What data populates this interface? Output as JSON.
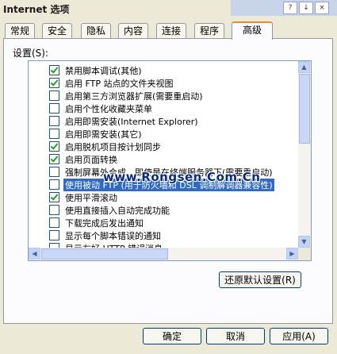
{
  "window": {
    "title": "Internet 选项"
  },
  "title_buttons": [
    "?",
    "↓",
    "×"
  ],
  "tabs": [
    {
      "label": "常规",
      "active": false
    },
    {
      "label": "安全",
      "active": false
    },
    {
      "label": "隐私",
      "active": false
    },
    {
      "label": "内容",
      "active": false
    },
    {
      "label": "连接",
      "active": false
    },
    {
      "label": "程序",
      "active": false
    },
    {
      "label": "高级",
      "active": true
    }
  ],
  "settings_label": "设置(S):",
  "settings": [
    {
      "label": "禁用脚本调试(其他)",
      "checked": true
    },
    {
      "label": "启用 FTP 站点的文件夹视图",
      "checked": true
    },
    {
      "label": "启用第三方浏览器扩展(需要重启动)",
      "checked": false
    },
    {
      "label": "启用个性化收藏夹菜单",
      "checked": false
    },
    {
      "label": "启用即需安装(Internet Explorer)",
      "checked": false
    },
    {
      "label": "启用即需安装(其它)",
      "checked": false
    },
    {
      "label": "启用脱机项目按计划同步",
      "checked": true
    },
    {
      "label": "启用页面转换",
      "checked": true
    },
    {
      "label": "强制屏幕外合成，即使是在终端服务器下(需要重启动)",
      "checked": false
    },
    {
      "label": "使用被动 FTP (用于防火墙和 DSL 调制解调器兼容性)",
      "checked": false,
      "selected": true
    },
    {
      "label": "使用平滑滚动",
      "checked": true
    },
    {
      "label": "使用直接插入自动完成功能",
      "checked": false
    },
    {
      "label": "下载完成后发出通知",
      "checked": false
    },
    {
      "label": "显示每个脚本错误的通知",
      "checked": false
    },
    {
      "label": "显示友好 HTTP 错误消息",
      "checked": false
    }
  ],
  "watermark": "www.Rongsen.Com.Cn",
  "buttons": {
    "restore_defaults": "还原默认设置(R)",
    "ok": "确定",
    "cancel": "取消",
    "apply": "应用(A)"
  }
}
